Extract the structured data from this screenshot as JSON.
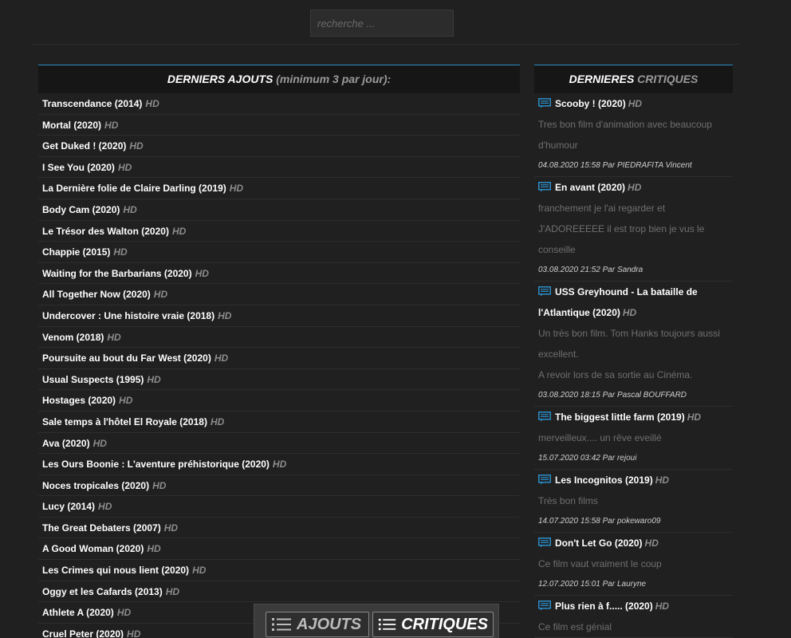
{
  "search": {
    "placeholder": "recherche ..."
  },
  "left": {
    "title_main": "DERNIERS AJOUTS",
    "title_sub": "(minimum 3 par jour):",
    "items": [
      {
        "title": "Transcendance (2014)",
        "badge": "HD"
      },
      {
        "title": "Mortal (2020)",
        "badge": "HD"
      },
      {
        "title": "Get Duked ! (2020)",
        "badge": "HD"
      },
      {
        "title": "I See You (2020)",
        "badge": "HD"
      },
      {
        "title": "La Dernière folie de Claire Darling (2019)",
        "badge": "HD"
      },
      {
        "title": "Body Cam (2020)",
        "badge": "HD"
      },
      {
        "title": "Le Trésor des Walton (2020)",
        "badge": "HD"
      },
      {
        "title": "Chappie (2015)",
        "badge": "HD"
      },
      {
        "title": "Waiting for the Barbarians (2020)",
        "badge": "HD"
      },
      {
        "title": "All Together Now (2020)",
        "badge": "HD"
      },
      {
        "title": "Undercover : Une histoire vraie (2018)",
        "badge": "HD"
      },
      {
        "title": "Venom (2018)",
        "badge": "HD"
      },
      {
        "title": "Poursuite au bout du Far West (2020)",
        "badge": "HD"
      },
      {
        "title": "Usual Suspects (1995)",
        "badge": "HD"
      },
      {
        "title": "Hostages (2020)",
        "badge": "HD"
      },
      {
        "title": "Sale temps à l'hôtel El Royale (2018)",
        "badge": "HD"
      },
      {
        "title": "Ava (2020)",
        "badge": "HD"
      },
      {
        "title": "Les Ours Boonie : L'aventure préhistorique (2020)",
        "badge": "HD"
      },
      {
        "title": "Noces tropicales (2020)",
        "badge": "HD"
      },
      {
        "title": "Lucy (2014)",
        "badge": "HD"
      },
      {
        "title": "The Great Debaters (2007)",
        "badge": "HD"
      },
      {
        "title": "A Good Woman (2020)",
        "badge": "HD"
      },
      {
        "title": "Les Crimes qui nous lient (2020)",
        "badge": "HD"
      },
      {
        "title": "Oggy et les Cafards (2013)",
        "badge": "HD"
      },
      {
        "title": "Athlete A (2020)",
        "badge": "HD"
      },
      {
        "title": "Cruel Peter (2020)",
        "badge": "HD"
      }
    ]
  },
  "right": {
    "title_main": "DERNIERES",
    "title_sub": "CRITIQUES",
    "items": [
      {
        "title": "Scooby ! (2020)",
        "badge": "HD",
        "lines": [
          "Tres bon film d'animation avec beaucoup d'humour"
        ],
        "meta": "04.08.2020 15:58 Par PIEDRAFITA Vincent"
      },
      {
        "title": "En avant (2020)",
        "badge": "HD",
        "lines": [
          "franchement je l'ai regarder et J'ADOREEEEE il est trop bien je vus le conseille"
        ],
        "meta": "03.08.2020 21:52 Par Sandra"
      },
      {
        "title": "USS Greyhound - La bataille de l'Atlantique (2020)",
        "badge": "HD",
        "lines": [
          "Un très bon film. Tom Hanks toujours aussi excellent.",
          "A revoir lors de sa sortie au Cinéma."
        ],
        "meta": "03.08.2020 18:15 Par Pascal BOUFFARD"
      },
      {
        "title": "The biggest little farm (2019)",
        "badge": "HD",
        "lines": [
          "merveilleux.... un rêve eveillé"
        ],
        "meta": "15.07.2020 03:42 Par rejoui"
      },
      {
        "title": "Les Incognitos (2019)",
        "badge": "HD",
        "lines": [
          "Très bon films"
        ],
        "meta": "14.07.2020 15:58 Par pokewaro09"
      },
      {
        "title": "Don't Let Go (2020)",
        "badge": "HD",
        "lines": [
          "Ce film vaut vraiment le coup"
        ],
        "meta": "12.07.2020 15:01 Par Lauryne"
      },
      {
        "title": "Plus rien à f..... (2020)",
        "badge": "HD",
        "lines": [
          "Ce film est génial"
        ],
        "meta": ""
      }
    ]
  },
  "bottom": {
    "ajouts_label": "AJOUTS",
    "critiques_label": "CRITIQUES"
  },
  "colors": {
    "accent": "#2a8cc7",
    "background": "#202020",
    "badge": "#8c8c8c"
  },
  "icons": {
    "comment": "comment-icon",
    "list": "list-icon"
  }
}
